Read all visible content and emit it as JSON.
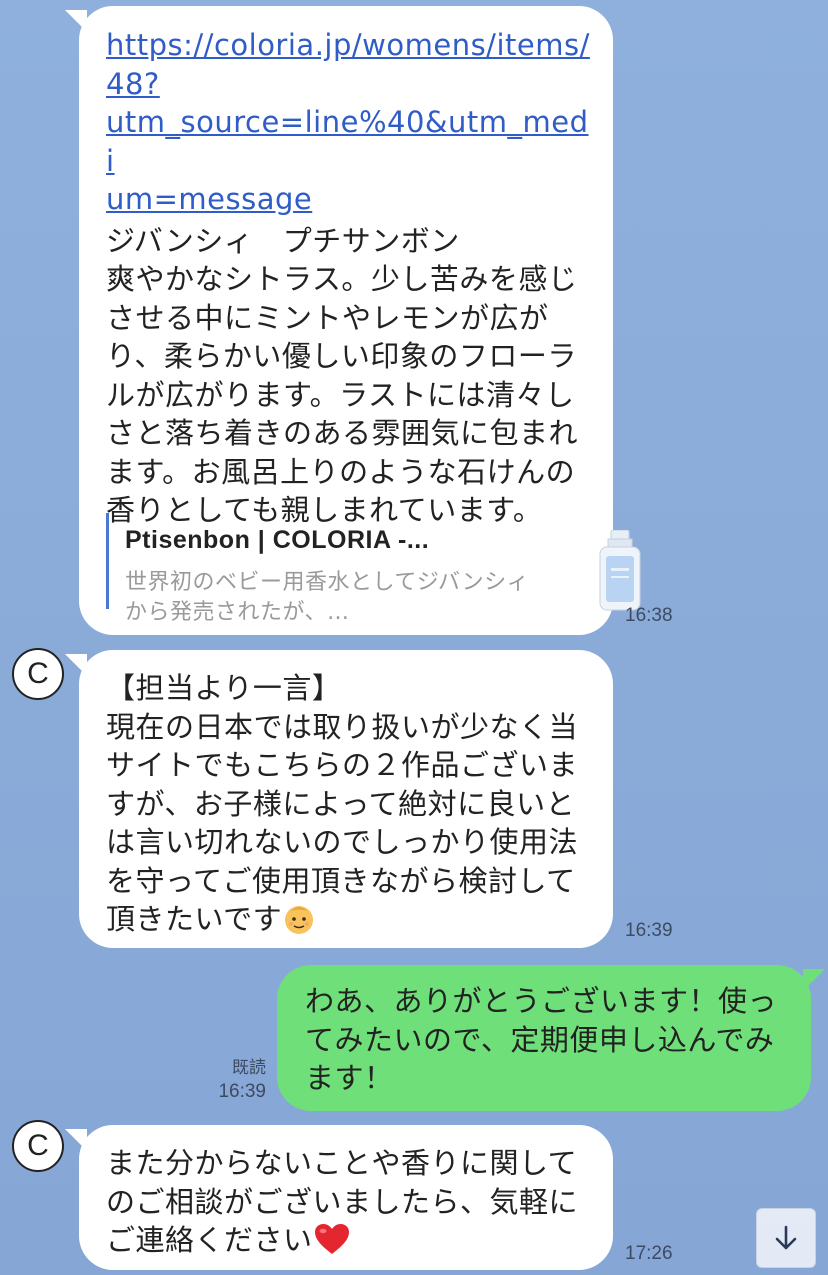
{
  "messages": {
    "m1": {
      "url_lines": [
        "https://coloria.jp/womens/items/",
        "48?",
        "utm_source=line%40&utm_medi",
        "um=message"
      ],
      "title_line": "ジバンシィ　プチサンボン",
      "body": "爽やかなシトラス。少し苦みを感じさせる中にミントやレモンが広がり、柔らかい優しい印象のフローラルが広がります。ラストには清々しさと落ち着きのある雰囲気に包まれます。お風呂上りのような石けんの香りとしても親しまれています。",
      "preview_title": "Ptisenbon | COLORIA -...",
      "preview_desc": "世界初のベビー用香水としてジバンシィから発売されたが、…",
      "time": "16:38"
    },
    "m2": {
      "heading": "【担当より一言】",
      "body": "現在の日本では取り扱いが少なく当サイトでもこちらの２作品ございますが、お子様によって絶対に良いとは言い切れないのでしっかり使用法を守ってご使用頂きながら検討して頂きたいです",
      "time": "16:39",
      "avatar_letter": "C"
    },
    "m3": {
      "body": "わあ、ありがとうございます！使ってみたいので、定期便申し込んでみます！",
      "read_label": "既読",
      "time": "16:39"
    },
    "m4": {
      "body": "また分からないことや香りに関してのご相談がございましたら、気軽にご連絡ください",
      "time": "17:26",
      "avatar_letter": "C"
    }
  },
  "icons": {
    "scroll_down": "arrow-down-icon",
    "emoji_1": "baby-face-emoji",
    "emoji_2": "red-heart-emoji"
  },
  "colors": {
    "incoming_bubble": "#ffffff",
    "outgoing_bubble": "#6fdf7a",
    "link": "#2f5cc8",
    "background": "#8aaad8"
  }
}
